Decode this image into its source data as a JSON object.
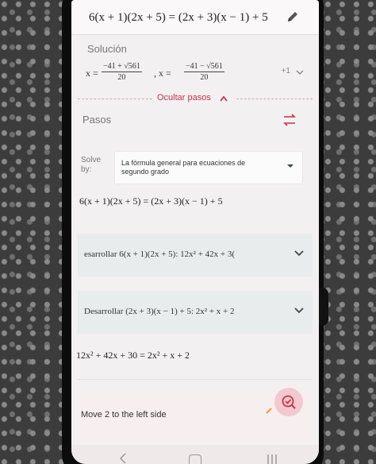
{
  "problem": {
    "equation": "6(x + 1)(2x + 5) = (2x + 3)(x − 1) + 5",
    "edit_icon": "pencil-icon"
  },
  "solution": {
    "label": "Solución",
    "x_prefix": "x =",
    "root1_numerator": "−41 + √561",
    "root1_denominator": "20",
    "separator": ", x =",
    "root2_numerator": "−41 − √561",
    "root2_denominator": "20",
    "more": "+1"
  },
  "toggle": {
    "hide_steps": "Ocultar pasos"
  },
  "steps": {
    "title": "Pasos",
    "solve_by_label": "Solve by:",
    "method": "La fórmula general para ecuaciones de segundo grado",
    "equation": "6(x + 1)(2x + 5) = (2x + 3)(x − 1) + 5",
    "items": [
      {
        "text": "esarrollar 6(x + 1)(2x + 5):   12x² + 42x + 3("
      },
      {
        "text": "Desarrollar (2x + 3)(x − 1) + 5:   2x² + x + 2"
      }
    ],
    "result": "12x² + 42x + 30 = 2x² + x + 2",
    "move_step": "Move 2 to the left side"
  },
  "colors": {
    "accent": "#c8324a",
    "card": "#e9ecec"
  }
}
